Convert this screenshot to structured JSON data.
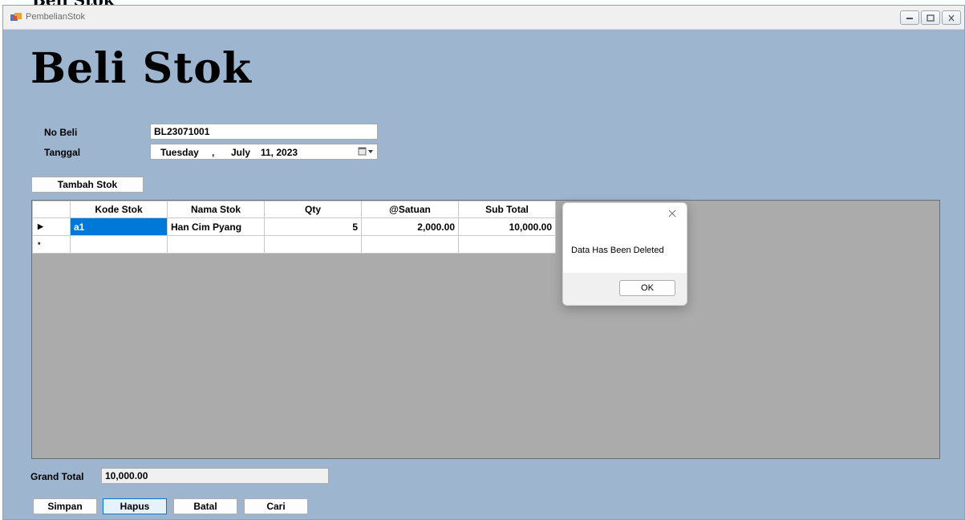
{
  "heading_strip": "Beli Stok",
  "window": {
    "title": "PembelianStok",
    "heading": "Beli Stok"
  },
  "form": {
    "no_beli_label": "No Beli",
    "no_beli_value": "BL23071001",
    "tanggal_label": "Tanggal",
    "tanggal_day": "Tuesday",
    "tanggal_sep": ",",
    "tanggal_month": "July",
    "tanggal_date": "11, 2023"
  },
  "buttons": {
    "tambah_stok": "Tambah Stok",
    "simpan": "Simpan",
    "hapus": "Hapus",
    "batal": "Batal",
    "cari": "Cari"
  },
  "grid": {
    "columns": [
      "Kode Stok",
      "Nama Stok",
      "Qty",
      "@Satuan",
      "Sub Total"
    ],
    "rows": [
      {
        "kode": "a1",
        "nama": "Han Cim Pyang",
        "qty": "5",
        "satuan": "2,000.00",
        "subtotal": "10,000.00"
      }
    ],
    "current_row_marker": "▶",
    "new_row_marker": "*"
  },
  "totals": {
    "grand_total_label": "Grand Total",
    "grand_total_value": "10,000.00"
  },
  "dialog": {
    "message": "Data Has Been Deleted",
    "ok_label": "OK"
  },
  "colors": {
    "form_background": "#9db5cf",
    "grid_background": "#ababab",
    "selection": "#0078d7"
  }
}
